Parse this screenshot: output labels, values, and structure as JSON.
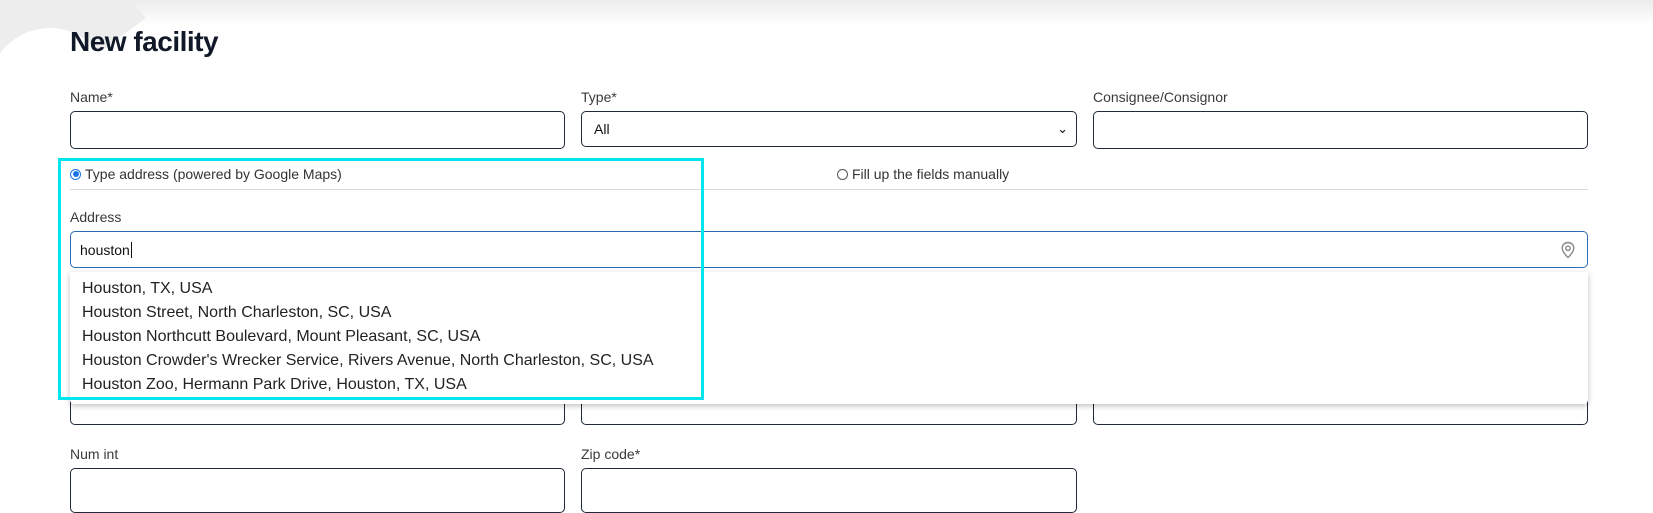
{
  "page": {
    "title": "New facility"
  },
  "form": {
    "name": {
      "label": "Name*",
      "value": ""
    },
    "type": {
      "label": "Type*",
      "value": "All"
    },
    "consignee": {
      "label": "Consignee/Consignor",
      "value": ""
    },
    "address_mode": {
      "google": {
        "label": "Type address (powered by Google Maps)",
        "selected": true
      },
      "manual": {
        "label": "Fill up the fields manually",
        "selected": false
      }
    },
    "address": {
      "label": "Address",
      "value": "houston"
    },
    "num_int": {
      "label": "Num int",
      "value": ""
    },
    "zip": {
      "label": "Zip code*",
      "value": ""
    }
  },
  "suggestions": [
    "Houston, TX, USA",
    "Houston Street, North Charleston, SC, USA",
    "Houston Northcutt Boulevard, Mount Pleasant, SC, USA",
    "Houston Crowder's Wrecker Service, Rivers Avenue, North Charleston, SC, USA",
    "Houston Zoo, Hermann Park Drive, Houston, TX, USA"
  ],
  "icons": {
    "address_pin": "location-pin-icon",
    "type_dropdown": "chevron-down-icon"
  },
  "colors": {
    "highlight": "#00e5ee",
    "radio_selected": "#1a73e8",
    "input_focus_border": "#2b6cb0"
  }
}
